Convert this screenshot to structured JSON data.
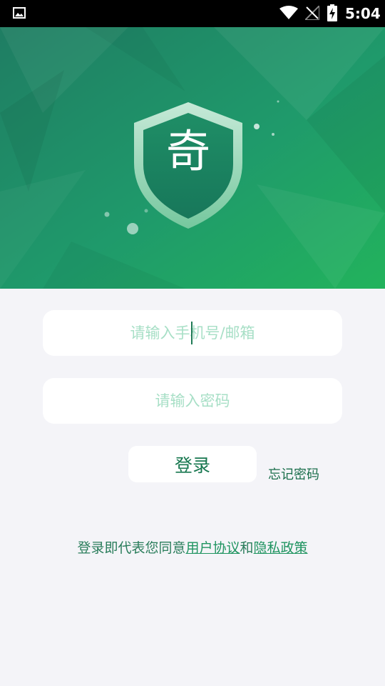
{
  "status_bar": {
    "time": "5:04",
    "icons": [
      "gallery-icon",
      "wifi-icon",
      "no-signal-icon",
      "battery-charging-icon"
    ]
  },
  "header": {
    "logo_char": "奇",
    "colors": {
      "gradient_start": "#1f7d63",
      "gradient_end": "#22b35c",
      "shield": "#1d8b62"
    }
  },
  "form": {
    "phone_placeholder": "请输入手机号/邮箱",
    "phone_value": "",
    "password_placeholder": "请输入密码",
    "password_value": "",
    "login_label": "登录",
    "forgot_label": "忘记密码"
  },
  "agreement": {
    "prefix": "登录即代表您同意",
    "user_agreement": "用户协议",
    "and": "和",
    "privacy_policy": "隐私政策"
  },
  "colors": {
    "background": "#f4f4f8",
    "accent": "#17774f",
    "placeholder": "#a7dfc6"
  }
}
